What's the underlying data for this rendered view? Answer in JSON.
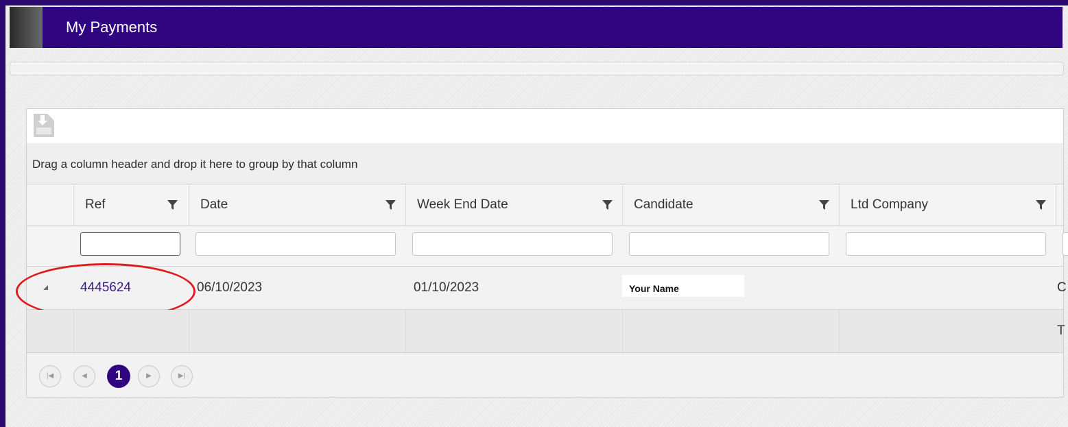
{
  "page": {
    "title": "My Payments",
    "accent_color": "#2f0680"
  },
  "toolbar": {
    "export_icon": "export-document-icon"
  },
  "grid": {
    "group_hint": "Drag a column header and drop it here to group by that column",
    "columns": [
      {
        "label": "Ref"
      },
      {
        "label": "Date"
      },
      {
        "label": "Week End Date"
      },
      {
        "label": "Candidate"
      },
      {
        "label": "Ltd Company"
      }
    ],
    "filter_icon": "funnel-icon",
    "rows": [
      {
        "ref": "4445624",
        "date": "06/10/2023",
        "week_end_date": "01/10/2023",
        "candidate": "Your Name",
        "ltd_company": "",
        "cut_off": "C"
      }
    ],
    "footer": {
      "cut_off": "T"
    },
    "annotation_color": "#e01b1b"
  },
  "pager": {
    "current_page": "1",
    "first_icon": "first-page-icon",
    "prev_icon": "prev-page-icon",
    "next_icon": "next-page-icon",
    "last_icon": "last-page-icon"
  }
}
